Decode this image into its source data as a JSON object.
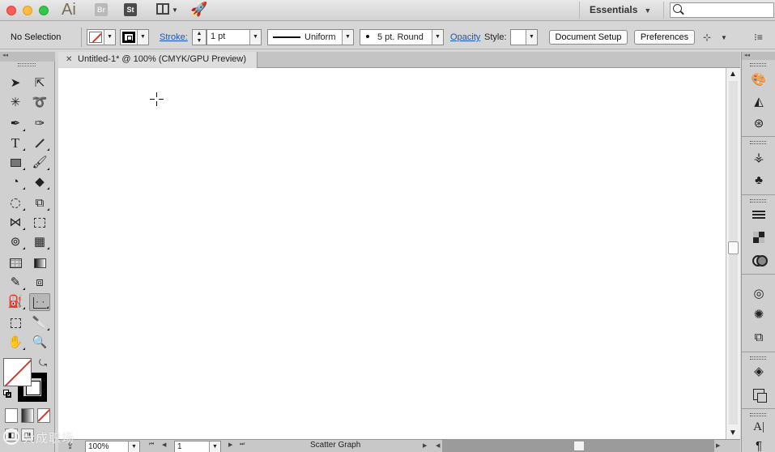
{
  "app": {
    "logo_text": "Ai",
    "bridge_badge": "Br",
    "stock_badge": "St",
    "workspace_label": "Essentials",
    "search_placeholder": ""
  },
  "control_bar": {
    "selection_status": "No Selection",
    "stroke_label": "Stroke:",
    "stroke_weight": "1 pt",
    "variable_width_profile": "Uniform",
    "brush_definition": "5 pt. Round",
    "opacity_label": "Opacity",
    "style_label": "Style:",
    "document_setup_button": "Document Setup",
    "preferences_button": "Preferences"
  },
  "document": {
    "tab_title": "Untitled-1* @ 100% (CMYK/GPU Preview)"
  },
  "status_bar": {
    "zoom": "100%",
    "artboard_number": "1",
    "current_tool": "Scatter Graph"
  },
  "toolbar": {
    "active_tool": "scatter-graph-tool"
  },
  "watermark": {
    "text": "大成职场"
  },
  "colors": {
    "none_slash": "#e0352b",
    "link_blue": "#1a56b4",
    "canvas": "#ffffff"
  }
}
